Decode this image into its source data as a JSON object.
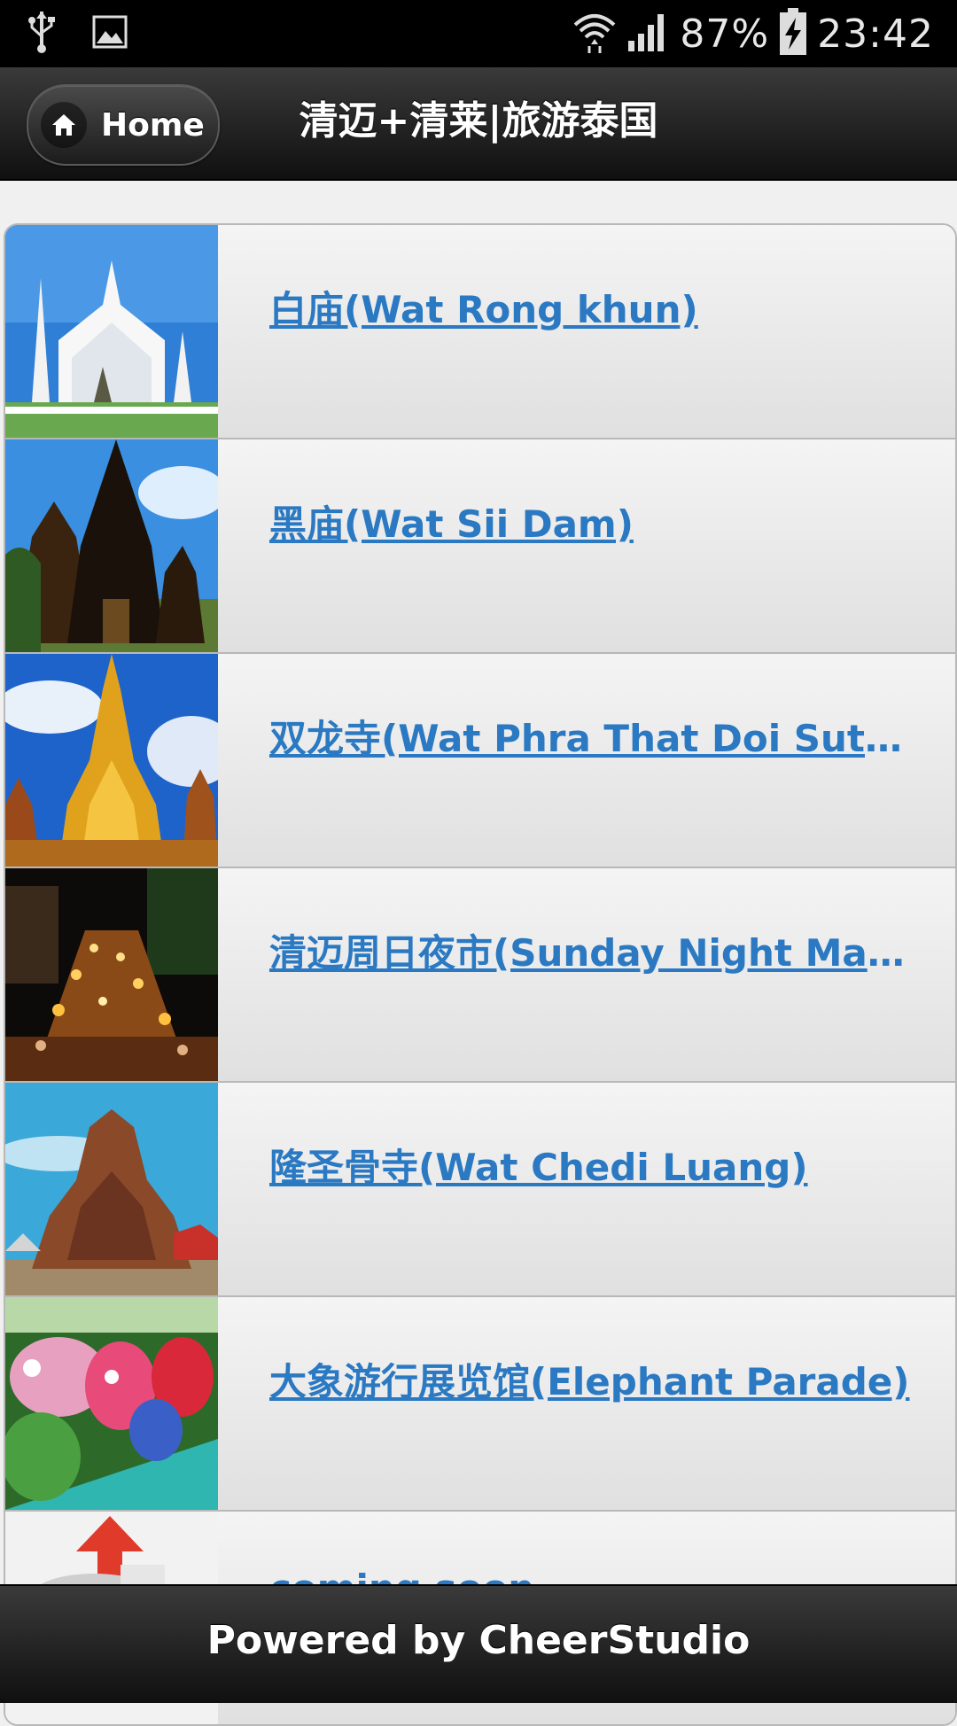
{
  "status_bar": {
    "battery": "87%",
    "time": "23:42",
    "icons": [
      "usb-icon",
      "image-icon",
      "wifi-icon",
      "signal-icon",
      "battery-charging-icon"
    ]
  },
  "header": {
    "home_label": "Home",
    "title": "清迈+清莱|旅游泰国"
  },
  "list": {
    "items": [
      {
        "label": "白庙(Wat Rong khun)",
        "thumb": "white-temple"
      },
      {
        "label": "黑庙(Wat Sii Dam)",
        "thumb": "black-temple"
      },
      {
        "label": "双龙寺(Wat Phra That Doi Suthep)",
        "thumb": "golden-stupa"
      },
      {
        "label": "清迈周日夜市(Sunday Night Market)",
        "thumb": "night-market"
      },
      {
        "label": "隆圣骨寺(Wat Chedi Luang)",
        "thumb": "chedi"
      },
      {
        "label": "大象游行展览馆(Elephant Parade)",
        "thumb": "elephants"
      },
      {
        "label": "coming soon",
        "thumb": "coming-soon"
      }
    ]
  },
  "footer": {
    "text": "Powered by CheerStudio"
  },
  "colors": {
    "link": "#2a79c2",
    "bar_dark": "#101010"
  }
}
